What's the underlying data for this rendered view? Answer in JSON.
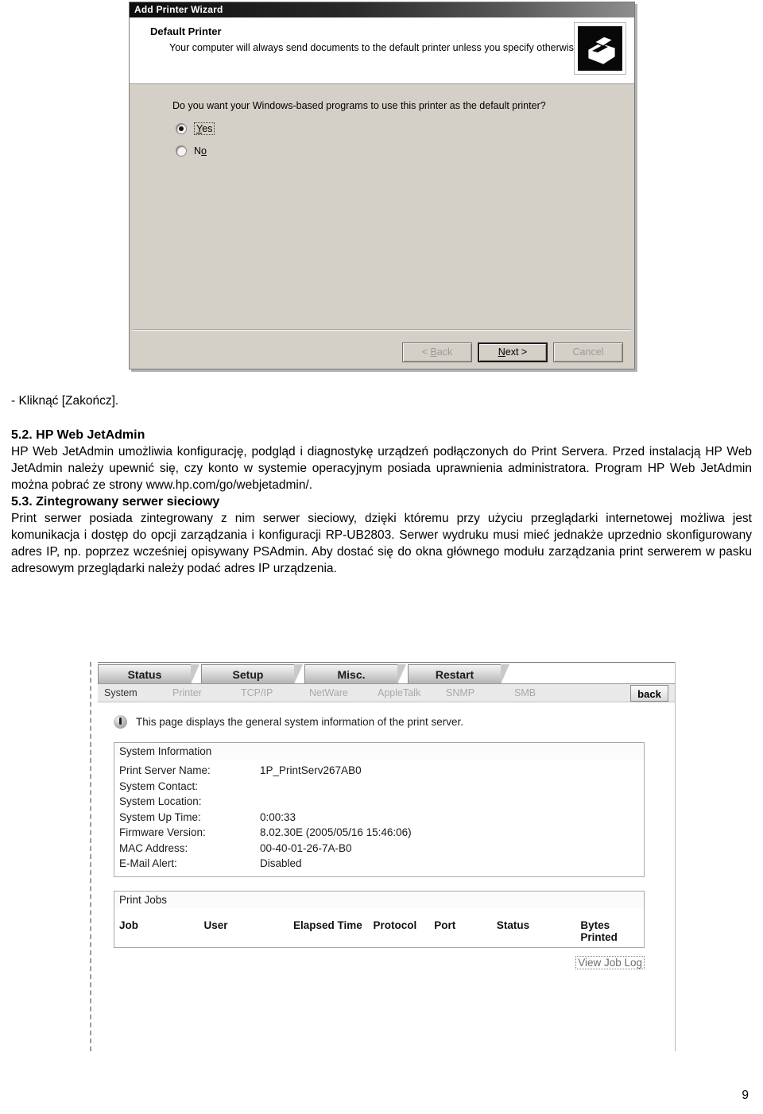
{
  "wizard": {
    "title": "Add Printer Wizard",
    "header_title": "Default Printer",
    "header_sub": "Your computer will always send documents to the default printer unless you specify otherwise.",
    "printer_icon": "printer-icon",
    "question": "Do you want your Windows-based programs to use this printer as the default printer?",
    "options": [
      {
        "label_pre": "",
        "label_u": "Y",
        "label_post": "es",
        "checked": true,
        "focused": true
      },
      {
        "label_pre": "N",
        "label_u": "o",
        "label_post": "",
        "checked": false,
        "focused": false
      }
    ],
    "buttons": [
      {
        "pre": "< ",
        "u": "B",
        "post": "ack",
        "enabled": false
      },
      {
        "pre": "",
        "u": "N",
        "post": "ext >",
        "enabled": true
      },
      {
        "pre": "Cancel",
        "u": "",
        "post": "",
        "enabled": false
      }
    ]
  },
  "document": {
    "click_line": "- Kliknąć [Zakończ].",
    "section_52_heading": "5.2. HP Web JetAdmin",
    "section_52_body": "HP Web JetAdmin umożliwia konfigurację, podgląd i diagnostykę urządzeń podłączonych do Print Servera. Przed instalacją HP Web JetAdmin należy upewnić się, czy konto w systemie operacyjnym posiada uprawnienia administratora. Program HP Web JetAdmin można pobrać ze strony www.hp.com/go/webjetadmin/.",
    "section_53_heading": "5.3. Zintegrowany serwer sieciowy",
    "section_53_body": "Print serwer posiada zintegrowany z nim serwer sieciowy, dzięki któremu przy użyciu przeglądarki internetowej możliwa jest komunikacja i dostęp do opcji zarządzania i konfiguracji RP-UB2803. Serwer wydruku musi mieć jednakże uprzednio skonfigurowany adres IP, np. poprzez wcześniej opisywany PSAdmin. Aby dostać się do okna głównego modułu zarządzania print serwerem w pasku adresowym przeglądarki należy podać adres IP urządzenia.",
    "page_number": "9"
  },
  "webui": {
    "tabs": [
      {
        "label": "Status",
        "active": true
      },
      {
        "label": "Setup",
        "active": false
      },
      {
        "label": "Misc.",
        "active": false
      },
      {
        "label": "Restart",
        "active": false
      }
    ],
    "subnav": [
      {
        "label": "System",
        "active": true
      },
      {
        "label": "Printer",
        "active": false
      },
      {
        "label": "TCP/IP",
        "active": false
      },
      {
        "label": "NetWare",
        "active": false
      },
      {
        "label": "AppleTalk",
        "active": false
      },
      {
        "label": "SNMP",
        "active": false
      },
      {
        "label": "SMB",
        "active": false
      }
    ],
    "back_label": "back",
    "info_icon": "info-bullet-icon",
    "info_text": "This page displays the general system information of the print server.",
    "system_information": {
      "panel_title": "System Information",
      "rows": [
        {
          "label": "Print Server Name:",
          "value": "1P_PrintServ267AB0"
        },
        {
          "label": "System Contact:",
          "value": ""
        },
        {
          "label": "System Location:",
          "value": ""
        },
        {
          "label": "System Up Time:",
          "value": "0:00:33"
        },
        {
          "label": "Firmware Version:",
          "value": "8.02.30E (2005/05/16 15:46:06)"
        },
        {
          "label": "MAC Address:",
          "value": "00-40-01-26-7A-B0"
        },
        {
          "label": "E-Mail Alert:",
          "value": "Disabled"
        }
      ]
    },
    "print_jobs": {
      "panel_title": "Print Jobs",
      "columns": [
        "Job",
        "User",
        "Elapsed Time",
        "Protocol",
        "Port",
        "Status",
        "Bytes Printed"
      ],
      "rows": []
    },
    "view_job_log_label": "View Job Log"
  }
}
